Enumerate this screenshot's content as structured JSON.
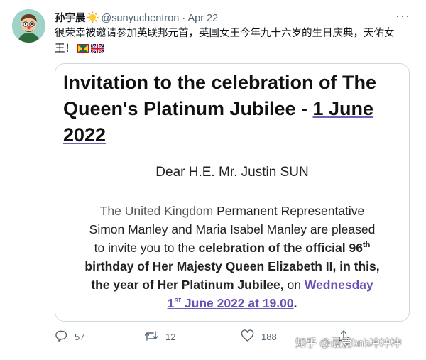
{
  "tweet": {
    "display_name": "孙宇晨",
    "handle": "@sunyuchentron",
    "separator": "·",
    "date": "Apr 22",
    "text_line1": "很荣幸被邀请参加英联邦元首，英国女王今年九十六岁的生日庆典，天佑女",
    "text_line2": "王！"
  },
  "card": {
    "title_line1": "Invitation to the celebration of The",
    "title_line2a": "Queen's Platinum Jubilee - ",
    "title_line2b": "1 June",
    "title_line3": "2022",
    "greeting": "Dear H.E. Mr. Justin SUN",
    "p1a": "The United Kingdom",
    "p1b": " Permanent Representative",
    "p2": "Simon Manley and Maria Isabel Manley are pleased",
    "p3a": "to invite you to the ",
    "p3b": "celebration of the official 96",
    "p3sup": "th",
    "p4": "birthday of Her Majesty Queen Elizabeth II, in this,",
    "p5a": "the year of Her Platinum Jubilee,",
    "p5b": " on ",
    "p5c": "Wednesday",
    "p6a": "1",
    "p6sup": "st",
    "p6b": " June 2022 at 19.00",
    "p6c": "."
  },
  "actions": {
    "replies": "57",
    "retweets": "12",
    "likes": "188"
  },
  "watermark": "知乎 @最爱bnb冲冲冲",
  "colors": {
    "accent_purple": "#6a4fb6",
    "muted": "#536471",
    "border": "#cfd9de"
  }
}
